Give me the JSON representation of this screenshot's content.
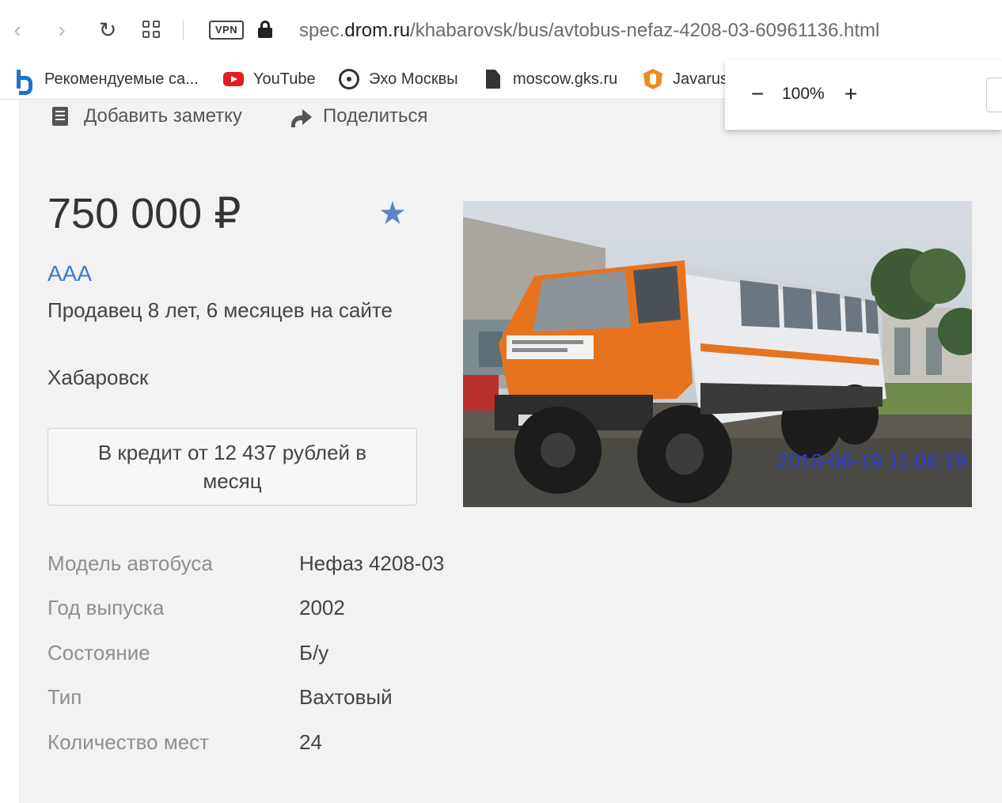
{
  "browser": {
    "url_prefix": "spec.",
    "url_host": "drom.ru",
    "url_path": "/khabarovsk/bus/avtobus-nefaz-4208-03-60961136.html",
    "vpn_label": "VPN",
    "bookmarks": [
      {
        "label": "Рекомендуемые са...",
        "icon": "bing-icon"
      },
      {
        "label": "YouTube",
        "icon": "youtube-icon"
      },
      {
        "label": "Эхо Москвы",
        "icon": "echo-icon"
      },
      {
        "label": "moscow.gks.ru",
        "icon": "document-icon"
      },
      {
        "label": "Javarus",
        "icon": "javarush-icon"
      }
    ],
    "zoom": {
      "minus": "−",
      "value": "100%",
      "plus": "+"
    }
  },
  "actions": {
    "add_note": "Добавить заметку",
    "share": "Поделиться"
  },
  "listing": {
    "price": "750 000 ₽",
    "favorite_icon": "star-icon",
    "seller_name": "AAA",
    "seller_tenure": "Продавец 8 лет, 6 месяцев на сайте",
    "city": "Хабаровск",
    "credit_button": "В кредит от 12 437 рублей в месяц",
    "photo_timestamp": "2018-06-19 11:06:19"
  },
  "specs": [
    {
      "label": "Модель автобуса",
      "value": "Нефаз 4208-03"
    },
    {
      "label": "Год выпуска",
      "value": "2002"
    },
    {
      "label": "Состояние",
      "value": "Б/у"
    },
    {
      "label": "Тип",
      "value": "Вахтовый"
    },
    {
      "label": "Количество мест",
      "value": "24"
    }
  ],
  "colors": {
    "link": "#3d7bc9",
    "star": "#5a86c8",
    "truck_cab": "#e8731e",
    "page_bg": "#f2f2f2"
  }
}
